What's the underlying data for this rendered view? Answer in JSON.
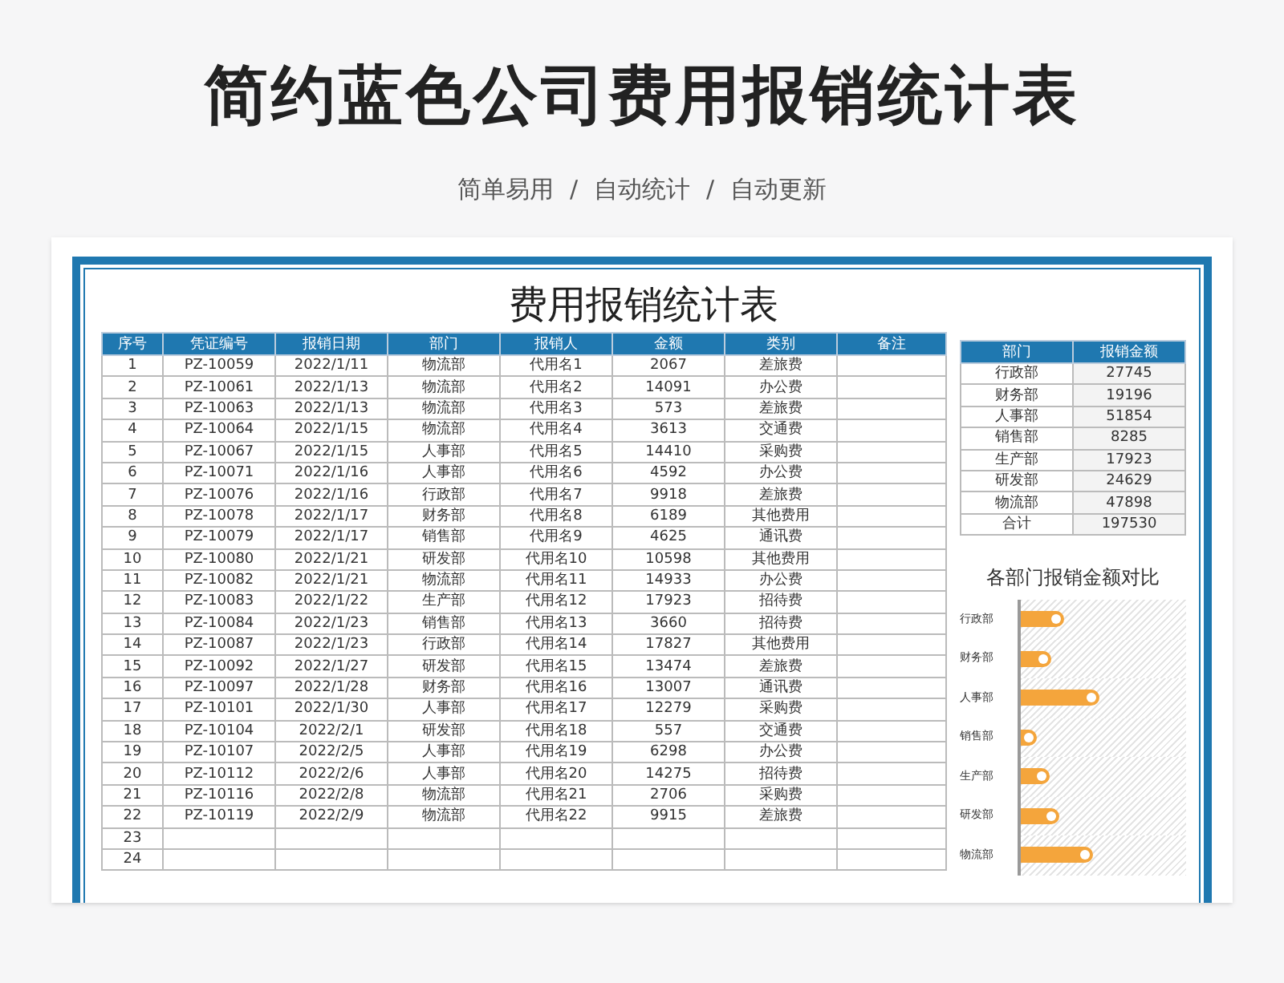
{
  "title": "简约蓝色公司费用报销统计表",
  "subtitle": [
    "简单易用",
    "自动统计",
    "自动更新"
  ],
  "separator": "/",
  "sheet": {
    "title": "费用报销统计表",
    "columns": [
      "序号",
      "凭证编号",
      "报销日期",
      "部门",
      "报销人",
      "金额",
      "类别",
      "备注"
    ],
    "rows": [
      [
        "1",
        "PZ-10059",
        "2022/1/11",
        "物流部",
        "代用名1",
        "2067",
        "差旅费",
        ""
      ],
      [
        "2",
        "PZ-10061",
        "2022/1/13",
        "物流部",
        "代用名2",
        "14091",
        "办公费",
        ""
      ],
      [
        "3",
        "PZ-10063",
        "2022/1/13",
        "物流部",
        "代用名3",
        "573",
        "差旅费",
        ""
      ],
      [
        "4",
        "PZ-10064",
        "2022/1/15",
        "物流部",
        "代用名4",
        "3613",
        "交通费",
        ""
      ],
      [
        "5",
        "PZ-10067",
        "2022/1/15",
        "人事部",
        "代用名5",
        "14410",
        "采购费",
        ""
      ],
      [
        "6",
        "PZ-10071",
        "2022/1/16",
        "人事部",
        "代用名6",
        "4592",
        "办公费",
        ""
      ],
      [
        "7",
        "PZ-10076",
        "2022/1/16",
        "行政部",
        "代用名7",
        "9918",
        "差旅费",
        ""
      ],
      [
        "8",
        "PZ-10078",
        "2022/1/17",
        "财务部",
        "代用名8",
        "6189",
        "其他费用",
        ""
      ],
      [
        "9",
        "PZ-10079",
        "2022/1/17",
        "销售部",
        "代用名9",
        "4625",
        "通讯费",
        ""
      ],
      [
        "10",
        "PZ-10080",
        "2022/1/21",
        "研发部",
        "代用名10",
        "10598",
        "其他费用",
        ""
      ],
      [
        "11",
        "PZ-10082",
        "2022/1/21",
        "物流部",
        "代用名11",
        "14933",
        "办公费",
        ""
      ],
      [
        "12",
        "PZ-10083",
        "2022/1/22",
        "生产部",
        "代用名12",
        "17923",
        "招待费",
        ""
      ],
      [
        "13",
        "PZ-10084",
        "2022/1/23",
        "销售部",
        "代用名13",
        "3660",
        "招待费",
        ""
      ],
      [
        "14",
        "PZ-10087",
        "2022/1/23",
        "行政部",
        "代用名14",
        "17827",
        "其他费用",
        ""
      ],
      [
        "15",
        "PZ-10092",
        "2022/1/27",
        "研发部",
        "代用名15",
        "13474",
        "差旅费",
        ""
      ],
      [
        "16",
        "PZ-10097",
        "2022/1/28",
        "财务部",
        "代用名16",
        "13007",
        "通讯费",
        ""
      ],
      [
        "17",
        "PZ-10101",
        "2022/1/30",
        "人事部",
        "代用名17",
        "12279",
        "采购费",
        ""
      ],
      [
        "18",
        "PZ-10104",
        "2022/2/1",
        "研发部",
        "代用名18",
        "557",
        "交通费",
        ""
      ],
      [
        "19",
        "PZ-10107",
        "2022/2/5",
        "人事部",
        "代用名19",
        "6298",
        "办公费",
        ""
      ],
      [
        "20",
        "PZ-10112",
        "2022/2/6",
        "人事部",
        "代用名20",
        "14275",
        "招待费",
        ""
      ],
      [
        "21",
        "PZ-10116",
        "2022/2/8",
        "物流部",
        "代用名21",
        "2706",
        "采购费",
        ""
      ],
      [
        "22",
        "PZ-10119",
        "2022/2/9",
        "物流部",
        "代用名22",
        "9915",
        "差旅费",
        ""
      ],
      [
        "23",
        "",
        "",
        "",
        "",
        "",
        "",
        ""
      ],
      [
        "24",
        "",
        "",
        "",
        "",
        "",
        "",
        ""
      ]
    ]
  },
  "summary": {
    "columns": [
      "部门",
      "报销金额"
    ],
    "rows": [
      [
        "行政部",
        "27745"
      ],
      [
        "财务部",
        "19196"
      ],
      [
        "人事部",
        "51854"
      ],
      [
        "销售部",
        "8285"
      ],
      [
        "生产部",
        "17923"
      ],
      [
        "研发部",
        "24629"
      ],
      [
        "物流部",
        "47898"
      ],
      [
        "合计",
        "197530"
      ]
    ]
  },
  "chart": {
    "title": "各部门报销金额对比",
    "labels": [
      "行政部",
      "财务部",
      "人事部",
      "销售部",
      "生产部",
      "研发部",
      "物流部"
    ]
  }
}
